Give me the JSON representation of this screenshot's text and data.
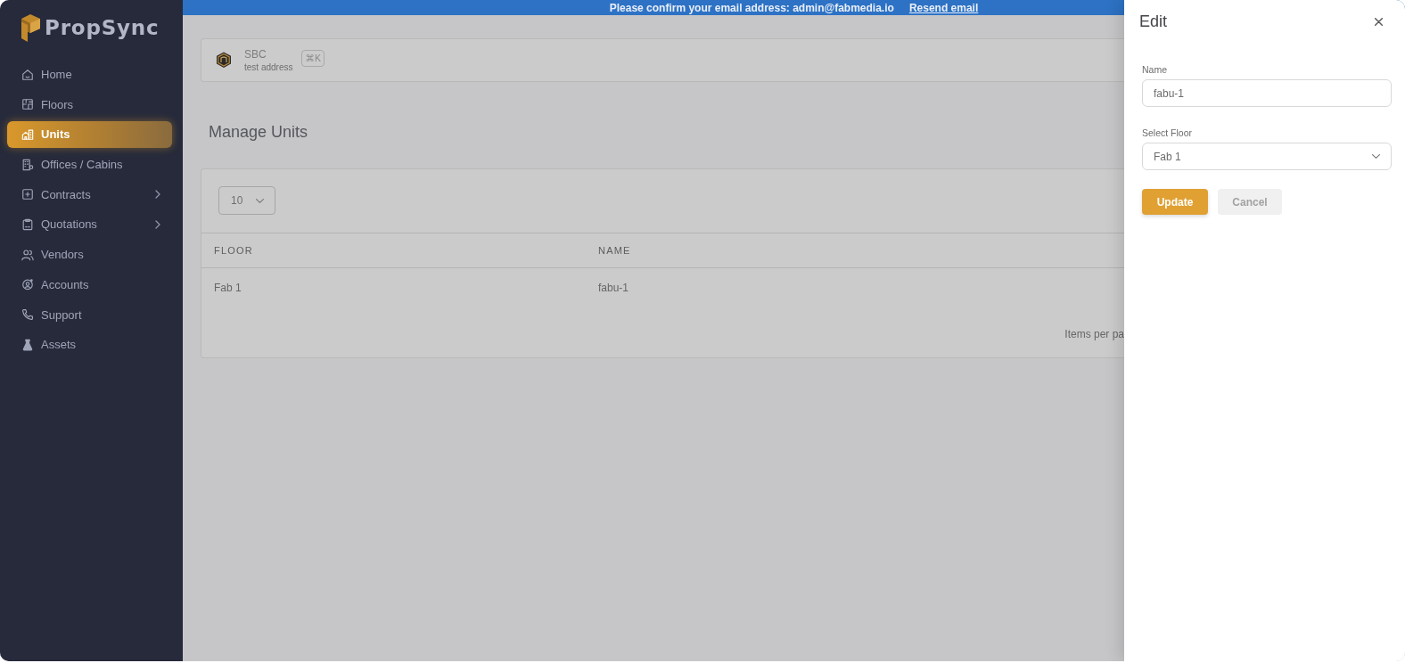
{
  "sidebar": {
    "brand": "PropSync",
    "items": [
      {
        "label": "Home",
        "selected": false,
        "has_submenu": false
      },
      {
        "label": "Floors",
        "selected": false,
        "has_submenu": false
      },
      {
        "label": "Units",
        "selected": true,
        "has_submenu": false
      },
      {
        "label": "Offices / Cabins",
        "selected": false,
        "has_submenu": false
      },
      {
        "label": "Contracts",
        "selected": false,
        "has_submenu": true
      },
      {
        "label": "Quotations",
        "selected": false,
        "has_submenu": true
      },
      {
        "label": "Vendors",
        "selected": false,
        "has_submenu": false
      },
      {
        "label": "Accounts",
        "selected": false,
        "has_submenu": false
      },
      {
        "label": "Support",
        "selected": false,
        "has_submenu": false
      },
      {
        "label": "Assets",
        "selected": false,
        "has_submenu": false
      }
    ]
  },
  "banner": {
    "message": "Please confirm your email address: admin@fabmedia.io",
    "link": "Resend email"
  },
  "workspace": {
    "name": "SBC",
    "address": "test address",
    "shortcut": "⌘K"
  },
  "page_title": "Manage Units",
  "table": {
    "page_size": "10",
    "columns": [
      "FLOOR",
      "NAME"
    ],
    "rows": [
      [
        "Fab 1",
        "fabu-1"
      ]
    ],
    "pagination_label": "Items per pa"
  },
  "drawer": {
    "title": "Edit",
    "fields": [
      {
        "kind": "text",
        "label": "Name",
        "value": "fabu-1"
      },
      {
        "kind": "select",
        "label": "Select Floor",
        "value": "Fab 1"
      }
    ],
    "buttons": [
      {
        "kind": "submit",
        "label": "Update"
      },
      {
        "kind": "cancel",
        "label": "Cancel"
      }
    ]
  }
}
